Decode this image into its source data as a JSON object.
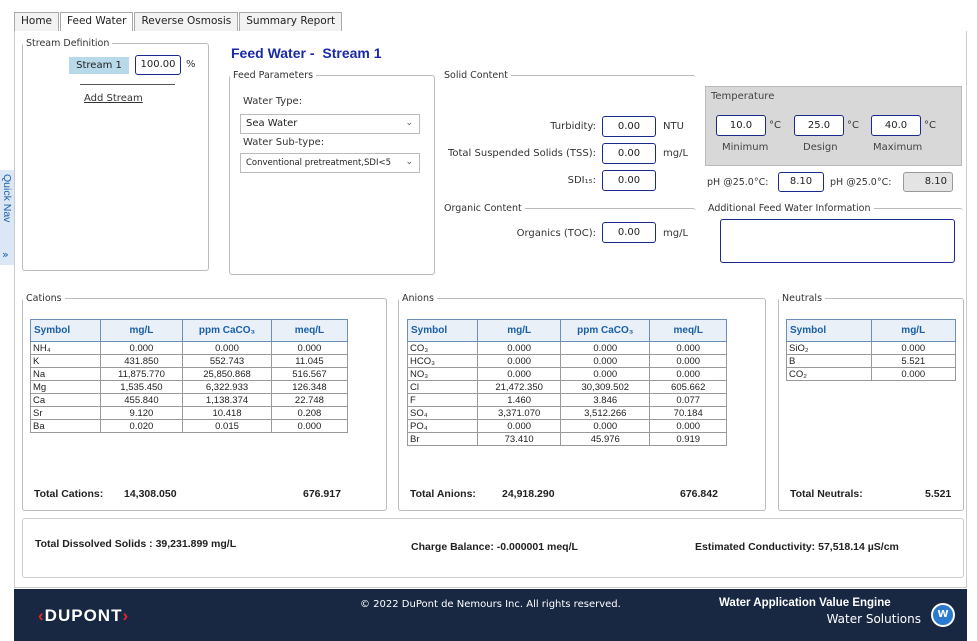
{
  "tabs": [
    "Home",
    "Feed Water",
    "Reverse Osmosis",
    "Summary Report"
  ],
  "quick_nav": "Quick Nav",
  "stream_def": {
    "legend": "Stream Definition",
    "stream_label": "Stream 1",
    "pct_value": "100.00",
    "pct_unit": "%",
    "add_stream": "Add Stream"
  },
  "page": {
    "title": "Feed Water - ",
    "stream": "Stream 1"
  },
  "feed_params": {
    "legend": "Feed Parameters",
    "water_type_label": "Water Type:",
    "water_type": "Sea Water",
    "subtype_label": "Water Sub-type:",
    "subtype": "Conventional pretreatment,SDI<5"
  },
  "solid": {
    "legend": "Solid Content",
    "turbidity_label": "Turbidity:",
    "turbidity": "0.00",
    "turbidity_unit": "NTU",
    "tss_label": "Total Suspended Solids (TSS):",
    "tss": "0.00",
    "tss_unit": "mg/L",
    "sdi_label": "SDI₁₅:",
    "sdi": "0.00"
  },
  "organic": {
    "legend": "Organic Content",
    "toc_label": "Organics (TOC):",
    "toc": "0.00",
    "toc_unit": "mg/L"
  },
  "temperature": {
    "legend": "Temperature",
    "min": "10.0",
    "design": "25.0",
    "max": "40.0",
    "unit": "°C",
    "min_label": "Minimum",
    "design_label": "Design",
    "max_label": "Maximum"
  },
  "ph": {
    "label1": "pH @25.0°C:",
    "value1": "8.10",
    "label2": "pH @25.0°C:",
    "value2": "8.10"
  },
  "additional": {
    "legend": "Additional Feed Water Information"
  },
  "cations": {
    "legend": "Cations",
    "headers": [
      "Symbol",
      "mg/L",
      "ppm CaCO₃",
      "meq/L"
    ],
    "rows": [
      [
        "NH₄",
        "0.000",
        "0.000",
        "0.000"
      ],
      [
        "K",
        "431.850",
        "552.743",
        "11.045"
      ],
      [
        "Na",
        "11,875.770",
        "25,850.868",
        "516.567"
      ],
      [
        "Mg",
        "1,535.450",
        "6,322.933",
        "126.348"
      ],
      [
        "Ca",
        "455.840",
        "1,138.374",
        "22.748"
      ],
      [
        "Sr",
        "9.120",
        "10.418",
        "0.208"
      ],
      [
        "Ba",
        "0.020",
        "0.015",
        "0.000"
      ]
    ],
    "total_label": "Total Cations:",
    "total_mg": "14,308.050",
    "total_meq": "676.917"
  },
  "anions": {
    "legend": "Anions",
    "headers": [
      "Symbol",
      "mg/L",
      "ppm CaCO₃",
      "meq/L"
    ],
    "rows": [
      [
        "CO₃",
        "0.000",
        "0.000",
        "0.000"
      ],
      [
        "HCO₃",
        "0.000",
        "0.000",
        "0.000"
      ],
      [
        "NO₃",
        "0.000",
        "0.000",
        "0.000"
      ],
      [
        "Cl",
        "21,472.350",
        "30,309.502",
        "605.662"
      ],
      [
        "F",
        "1.460",
        "3.846",
        "0.077"
      ],
      [
        "SO₄",
        "3,371.070",
        "3,512.266",
        "70.184"
      ],
      [
        "PO₄",
        "0.000",
        "0.000",
        "0.000"
      ],
      [
        "Br",
        "73.410",
        "45.976",
        "0.919"
      ]
    ],
    "total_label": "Total Anions:",
    "total_mg": "24,918.290",
    "total_meq": "676.842"
  },
  "neutrals": {
    "legend": "Neutrals",
    "headers": [
      "Symbol",
      "mg/L"
    ],
    "rows": [
      [
        "SiO₂",
        "0.000"
      ],
      [
        "B",
        "5.521"
      ],
      [
        "CO₂",
        "0.000"
      ]
    ],
    "total_label": "Total Neutrals:",
    "total_mg": "5.521"
  },
  "summary": {
    "tds": "Total Dissolved Solids : 39,231.899 mg/L",
    "charge": "Charge Balance: -0.000001 meq/L",
    "conductivity": "Estimated Conductivity: 57,518.14 µS/cm"
  },
  "footer": {
    "logo": "DUPONT",
    "copyright": "© 2022 DuPont de Nemours Inc. All rights reserved.",
    "app_name": "Water Application Value Engine",
    "app_sub": "Water Solutions",
    "badge": "W"
  }
}
